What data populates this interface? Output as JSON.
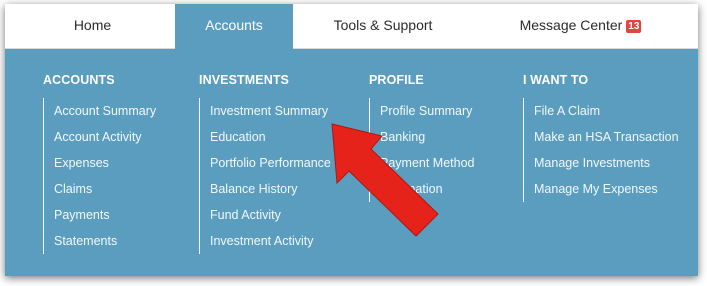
{
  "nav": {
    "tabs": [
      {
        "label": "Home",
        "active": false
      },
      {
        "label": "Accounts",
        "active": true
      },
      {
        "label": "Tools & Support",
        "active": false
      },
      {
        "label": "Message Center",
        "active": false,
        "badge": "13"
      }
    ]
  },
  "menu": {
    "accounts": {
      "heading": "ACCOUNTS",
      "items": [
        "Account Summary",
        "Account Activity",
        "Expenses",
        "Claims",
        "Payments",
        "Statements"
      ]
    },
    "investments": {
      "heading": "INVESTMENTS",
      "items": [
        "Investment Summary",
        "Education",
        "Portfolio Performance",
        "Balance History",
        "Fund Activity",
        "Investment Activity"
      ]
    },
    "profile": {
      "heading": "PROFILE",
      "items": [
        "Profile Summary",
        "Banking",
        "Payment Method",
        "Information"
      ]
    },
    "i_want_to": {
      "heading": "I WANT TO",
      "items": [
        "File A Claim",
        "Make an HSA Transaction",
        "Manage Investments",
        "Manage My Expenses"
      ]
    }
  },
  "colors": {
    "panel": "#5b9dbf",
    "badge": "#e0463f",
    "arrow": "#e5231b"
  },
  "annotation": {
    "icon": "red-arrow-icon",
    "points_to": "Investment Summary"
  }
}
